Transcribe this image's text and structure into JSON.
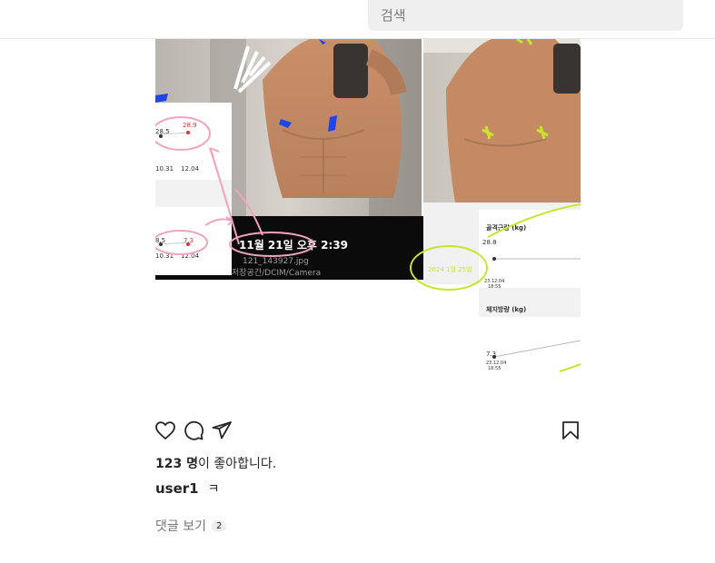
{
  "search": {
    "placeholder": "검색"
  },
  "post": {
    "image": {
      "left_photo": {
        "timestamp": "11월 21일 오후 2:39",
        "filename": "121_143927.jpg",
        "path": "저장공간/DCIM/Camera",
        "chart_top": {
          "value_a": "28.5",
          "value_b": "28.9",
          "date_a": "10.31",
          "date_b": "12.04"
        },
        "chart_bottom": {
          "value_a": "8.5",
          "value_b": "7.3",
          "date_a": "10.31",
          "date_b": "12.04"
        }
      },
      "right_photo": {
        "timestamp": "2024 1월 25일",
        "panel_top": {
          "title": "골격근량 (kg)",
          "value": "28.8",
          "date": "23.12.04",
          "time": "18:55"
        },
        "panel_bottom": {
          "title": "체지방량 (kg)",
          "value": "7.3",
          "date": "23.12.04",
          "time": "18:55"
        }
      }
    },
    "likes": {
      "count": "123 명",
      "suffix": "이 좋아합니다."
    },
    "caption": {
      "username": "user1",
      "text": "ㅋ"
    },
    "comments": {
      "label": "댓글 보기",
      "count": "2"
    }
  },
  "icons": [
    "heart-icon",
    "comment-icon",
    "share-icon",
    "bookmark-icon"
  ],
  "colors": {
    "pink_annotation": "#f2a3c0",
    "lime_annotation": "#c9e52b",
    "blue_annotation": "#1e46e6"
  }
}
